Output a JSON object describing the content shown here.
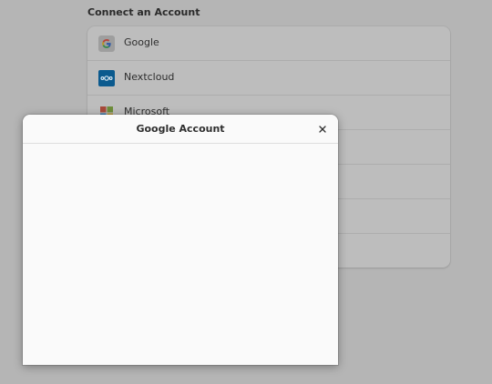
{
  "settings": {
    "section_title": "Connect an Account",
    "providers": [
      {
        "label": "Google",
        "icon": "google-icon"
      },
      {
        "label": "Nextcloud",
        "icon": "nextcloud-icon"
      },
      {
        "label": "Microsoft",
        "icon": "microsoft-icon"
      }
    ]
  },
  "dialog": {
    "title": "Google Account",
    "close_icon": "close-icon"
  },
  "colors": {
    "overlay_background": "#b5b5b5",
    "dialog_background": "#fafafa",
    "nextcloud_blue": "#0b6aa8",
    "google_blue": "#4285f4"
  }
}
